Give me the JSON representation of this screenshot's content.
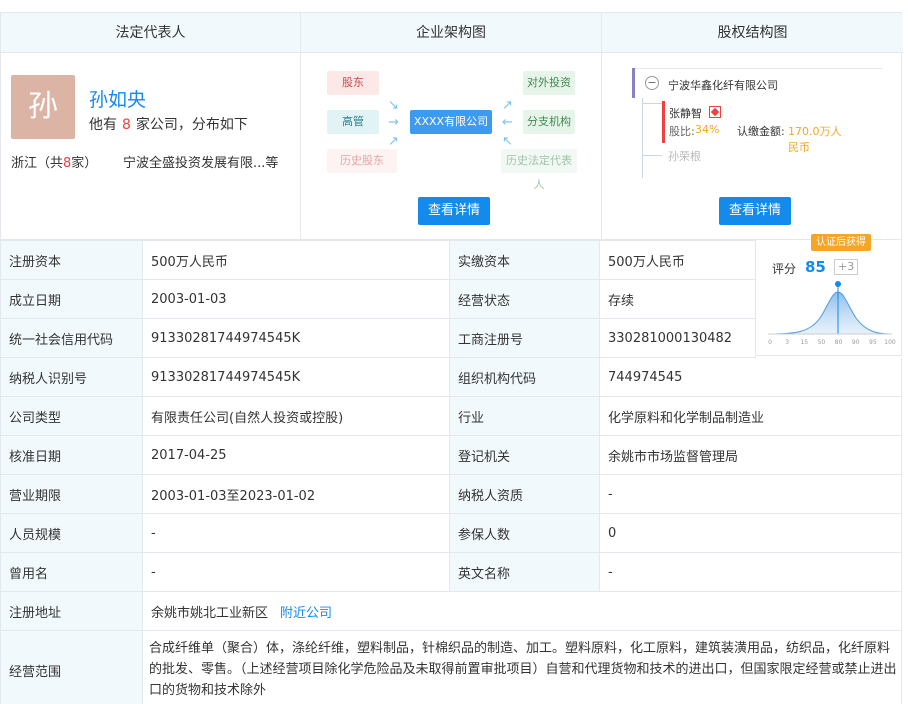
{
  "panels": {
    "legal_rep": {
      "title": "法定代表人",
      "avatar_char": "孙",
      "name": "孙如央",
      "sub_prefix": "他有",
      "company_count": "8",
      "sub_suffix": "家公司，分布如下",
      "region_prefix": "浙江（共",
      "region_count": "8",
      "region_suffix": "家）",
      "company_preview": "宁波全盛投资发展有限...等"
    },
    "structure": {
      "title": "企业架构图",
      "nodes": {
        "shareholder": "股东",
        "management": "高管",
        "history_shareholder": "历史股东",
        "center": "XXXX有限公司",
        "investment": "对外投资",
        "branch": "分支机构",
        "history_rep": "历史法定代表人"
      },
      "button": "查看详情"
    },
    "equity": {
      "title": "股权结构图",
      "company": "宁波华鑫化纤有限公司",
      "holder1_name": "张静智",
      "holder1_ratio_label": "股比:",
      "holder1_ratio": "34%",
      "holder1_amount_label": "认缴金额:",
      "holder1_amount": "170.0万人民币",
      "holder2_name": "孙荣根",
      "button": "查看详情"
    }
  },
  "score": {
    "tag": "认证后获得",
    "label": "评分",
    "value": "85",
    "delta": "+3",
    "axis_ticks": [
      "0",
      "3",
      "15",
      "50",
      "80",
      "90",
      "95",
      "100"
    ]
  },
  "table": [
    {
      "label": "注册资本",
      "value": "500万人民币",
      "label2": "实缴资本",
      "value2": "500万人民币"
    },
    {
      "label": "成立日期",
      "value": "2003-01-03",
      "label2": "经营状态",
      "value2": "存续"
    },
    {
      "label": "统一社会信用代码",
      "value": "91330281744974545K",
      "label2": "工商注册号",
      "value2": "330281000130482"
    },
    {
      "label": "纳税人识别号",
      "value": "91330281744974545K",
      "label2": "组织机构代码",
      "value2": "744974545"
    },
    {
      "label": "公司类型",
      "value": "有限责任公司(自然人投资或控股)",
      "label2": "行业",
      "value2": "化学原料和化学制品制造业"
    },
    {
      "label": "核准日期",
      "value": "2017-04-25",
      "label2": "登记机关",
      "value2": "余姚市市场监督管理局"
    },
    {
      "label": "营业期限",
      "value": "2003-01-03至2023-01-02",
      "label2": "纳税人资质",
      "value2": "-"
    },
    {
      "label": "人员规模",
      "value": "-",
      "label2": "参保人数",
      "value2": "0"
    },
    {
      "label": "曾用名",
      "value": "-",
      "label2": "英文名称",
      "value2": "-"
    }
  ],
  "address": {
    "label": "注册地址",
    "value": "余姚市姚北工业新区",
    "link": "附近公司"
  },
  "scope": {
    "label": "经营范围",
    "value": "合成纤维单（聚合）体，涤纶纤维，塑料制品，针棉织品的制造、加工。塑料原料，化工原料，建筑装潢用品，纺织品，化纤原料的批发、零售。（上述经营项目除化学危险品及未取得前置审批项目）自营和代理货物和技术的进出口，但国家限定经营或禁止进出口的货物和技术除外"
  }
}
